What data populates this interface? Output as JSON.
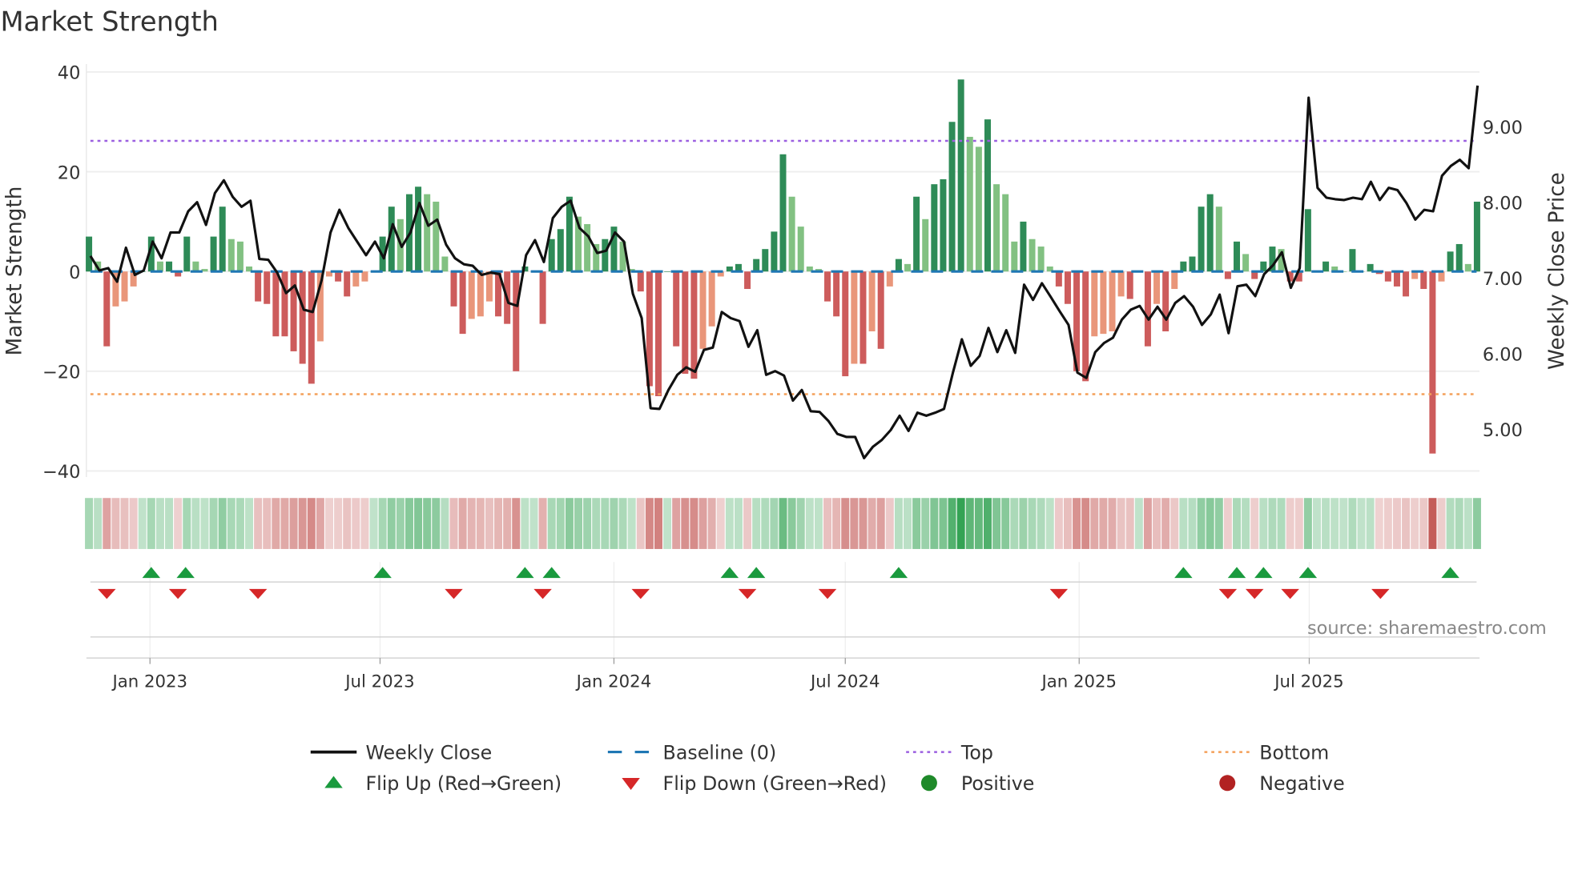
{
  "chart_data": {
    "type": "bar",
    "title": "Market Strength",
    "ylabel": "Market Strength",
    "y2label": "Weekly Close Price",
    "ylim": [
      -40,
      40
    ],
    "y2lim": [
      4.45,
      9.72
    ],
    "yticks": [
      "40",
      "20",
      "0",
      "−20",
      "−40"
    ],
    "ytick_values": [
      40,
      20,
      0,
      -20,
      -40
    ],
    "y2ticks": [
      "9.00",
      "8.00",
      "7.00",
      "6.00",
      "5.00"
    ],
    "y2tick_values": [
      9,
      8,
      7,
      6,
      5
    ],
    "xlim": [
      "2022-11-12",
      "2025-11-12"
    ],
    "xticks": [
      {
        "label": "Jan 2023",
        "date": "2023-01-01"
      },
      {
        "label": "Jul 2023",
        "date": "2023-07-01"
      },
      {
        "label": "Jan 2024",
        "date": "2024-01-01"
      },
      {
        "label": "Jul 2024",
        "date": "2024-07-01"
      },
      {
        "label": "Jan 2025",
        "date": "2025-01-01"
      },
      {
        "label": "Jul 2025",
        "date": "2025-07-01"
      }
    ],
    "start_date": "2022-11-14",
    "frequency": "weekly",
    "top_level": 26.2,
    "bottom_level": -24.6,
    "baseline": 0,
    "strength": [
      7,
      2,
      -15,
      -7,
      -6,
      -3,
      0,
      7,
      2,
      2,
      -1,
      7,
      2,
      0.5,
      7,
      13,
      6.5,
      6,
      1,
      -6,
      -6.5,
      -13,
      -13,
      -16,
      -18.5,
      -22.5,
      -14,
      -1,
      -2,
      -5,
      -3,
      -2,
      0,
      7,
      13,
      10.5,
      15.5,
      17,
      15.5,
      14,
      3,
      -7,
      -12.5,
      -9.5,
      -9,
      -6,
      -9,
      -10.5,
      -20,
      1,
      0,
      -10.5,
      6.5,
      8.5,
      15,
      11,
      9.5,
      5.5,
      6.5,
      9,
      6,
      0.5,
      -4,
      -23,
      -25,
      0,
      -15,
      -20.5,
      -21.5,
      -15.5,
      -11,
      -1,
      1,
      1.5,
      -3.5,
      2.5,
      4.5,
      8,
      23.5,
      15,
      9,
      1,
      0.5,
      -6,
      -9,
      -21,
      -18.5,
      -18.5,
      -12,
      -15.5,
      -3,
      2.5,
      1.5,
      15,
      10.5,
      17.5,
      18.5,
      30,
      38.5,
      27,
      25,
      30.5,
      17.5,
      15.5,
      6,
      10,
      6.5,
      5,
      1,
      -3,
      -6.5,
      -20,
      -22,
      -13,
      -12.5,
      -12,
      -5,
      -5.5,
      0,
      -15,
      -6.5,
      -12,
      -3.5,
      2,
      3,
      13,
      15.5,
      13,
      -1.5,
      6,
      3.5,
      -1.5,
      2,
      5,
      4.5,
      -2,
      -2,
      12.5,
      0,
      2,
      1,
      0,
      4.5,
      0,
      1.5,
      -0.5,
      -2,
      -3,
      -5,
      -1.5,
      -3.5,
      -36.5,
      -2,
      4,
      5.5,
      1.5,
      14
    ],
    "close": [
      7.29,
      7.1,
      7.13,
      6.95,
      7.4,
      7.04,
      7.1,
      7.48,
      7.26,
      7.6,
      7.6,
      7.88,
      8.0,
      7.7,
      8.12,
      8.29,
      8.07,
      7.94,
      8.02,
      7.25,
      7.24,
      7.07,
      6.8,
      6.9,
      6.58,
      6.55,
      6.97,
      7.6,
      7.9,
      7.66,
      7.48,
      7.3,
      7.48,
      7.26,
      7.71,
      7.41,
      7.6,
      7.99,
      7.69,
      7.77,
      7.44,
      7.26,
      7.18,
      7.16,
      7.04,
      7.07,
      7.05,
      6.67,
      6.63,
      7.3,
      7.5,
      7.21,
      7.79,
      7.94,
      8.02,
      7.66,
      7.55,
      7.33,
      7.36,
      7.6,
      7.48,
      6.79,
      6.47,
      5.28,
      5.27,
      5.52,
      5.72,
      5.82,
      5.76,
      6.05,
      6.08,
      6.55,
      6.47,
      6.43,
      6.09,
      6.31,
      5.72,
      5.77,
      5.71,
      5.38,
      5.52,
      5.24,
      5.23,
      5.11,
      4.94,
      4.9,
      4.9,
      4.62,
      4.77,
      4.86,
      4.99,
      5.18,
      4.98,
      5.22,
      5.18,
      5.22,
      5.27,
      5.75,
      6.19,
      5.84,
      5.97,
      6.34,
      6.02,
      6.31,
      6.01,
      6.91,
      6.71,
      6.93,
      6.75,
      6.56,
      6.38,
      5.75,
      5.68,
      6.02,
      6.14,
      6.21,
      6.45,
      6.58,
      6.63,
      6.45,
      6.62,
      6.45,
      6.67,
      6.76,
      6.62,
      6.38,
      6.52,
      6.78,
      6.27,
      6.89,
      6.91,
      6.76,
      7.05,
      7.17,
      7.34,
      6.87,
      7.13,
      9.38,
      8.19,
      8.06,
      8.04,
      8.03,
      8.06,
      8.04,
      8.27,
      8.03,
      8.19,
      8.16,
      7.99,
      7.77,
      7.9,
      7.88,
      8.35,
      8.48,
      8.56,
      8.45,
      9.54
    ],
    "flip_up_dates": [
      "2023-01-02",
      "2023-01-29",
      "2023-07-03",
      "2023-10-23",
      "2023-11-13",
      "2024-04-01",
      "2024-04-22",
      "2024-08-12",
      "2025-03-24",
      "2025-05-05",
      "2025-05-26",
      "2025-06-30",
      "2025-10-20"
    ],
    "flip_down_dates": [
      "2022-11-28",
      "2023-01-23",
      "2023-03-27",
      "2023-08-28",
      "2023-11-06",
      "2024-01-22",
      "2024-04-15",
      "2024-06-17",
      "2024-12-16",
      "2025-04-28",
      "2025-05-19",
      "2025-06-16",
      "2025-08-26"
    ],
    "legend": {
      "placement": "bottom",
      "items": [
        {
          "label": "Weekly Close",
          "kind": "line"
        },
        {
          "label": "Baseline (0)",
          "kind": "dash"
        },
        {
          "label": "Top",
          "kind": "dot-top"
        },
        {
          "label": "Bottom",
          "kind": "dot-bottom"
        },
        {
          "label": "Flip Up (Red→Green)",
          "kind": "tri-up"
        },
        {
          "label": "Flip Down (Green→Red)",
          "kind": "tri-down"
        },
        {
          "label": "Positive",
          "kind": "dot-pos"
        },
        {
          "label": "Negative",
          "kind": "dot-neg"
        }
      ]
    },
    "annotation": "source: sharemaestro.com",
    "colors": {
      "pos_rising": "#2e8b57",
      "pos_falling": "#82c182",
      "neg_falling": "#cd5c5c",
      "neg_rising": "#e9967a",
      "close": "#111111",
      "baseline": "#1f77b4",
      "top": "#9b5fe0",
      "bottom": "#f4a05a",
      "flip_up": "#1a9a3e",
      "flip_down": "#d62728",
      "positive": "#1f8a2a",
      "negative": "#b22222"
    }
  }
}
